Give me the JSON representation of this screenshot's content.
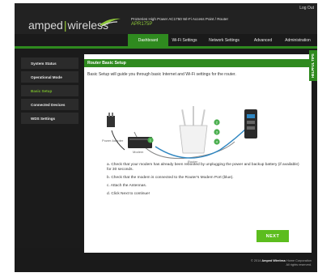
{
  "header": {
    "logo_left": "amped",
    "logo_right": "wireless",
    "product_name": "ProSeries High Power AC1750 Wi-Fi Access Point / Router",
    "product_model": "APR175P",
    "logout_label": "Log Out"
  },
  "nav": {
    "tabs": [
      {
        "label": "Dashboard"
      },
      {
        "label": "Wi-Fi Settings"
      },
      {
        "label": "Network Settings"
      },
      {
        "label": "Advanced"
      },
      {
        "label": "Administration"
      }
    ]
  },
  "sidebar": {
    "items": [
      {
        "label": "System Status"
      },
      {
        "label": "Operational Mode"
      },
      {
        "label": "Basic Setup"
      },
      {
        "label": "Connected Devices"
      },
      {
        "label": "WDS Settings"
      }
    ]
  },
  "content": {
    "title": "Router Basic Setup",
    "intro": "Basic Setup will guide you through basic Internet and Wi-Fi settings for the router.",
    "diagram": {
      "power_label": "Power Adapter",
      "modem_label": "Modem",
      "router_label": "Router",
      "badges": [
        "1",
        "2",
        "3",
        "4"
      ]
    },
    "steps": [
      "a. Check that your modem has already been rebooted by unplugging the power and backup battery (if available) for 30 seconds.",
      "b. Check that the modem is connected to the Router's Modem Port (blue).",
      "c. Attach the Antennas.",
      "d. Click Next to continue!"
    ],
    "next_label": "NEXT"
  },
  "helpful_tips": "HELPFUL TIPS",
  "footer": {
    "brand": "Amped Wireless",
    "line1_prefix": "© 2014",
    "line1_suffix": "Home Corporation",
    "line2": "All rights reserved."
  },
  "colors": {
    "accent": "#2f8a1f",
    "button": "#5cbd1e",
    "background": "#1a1a1a"
  }
}
